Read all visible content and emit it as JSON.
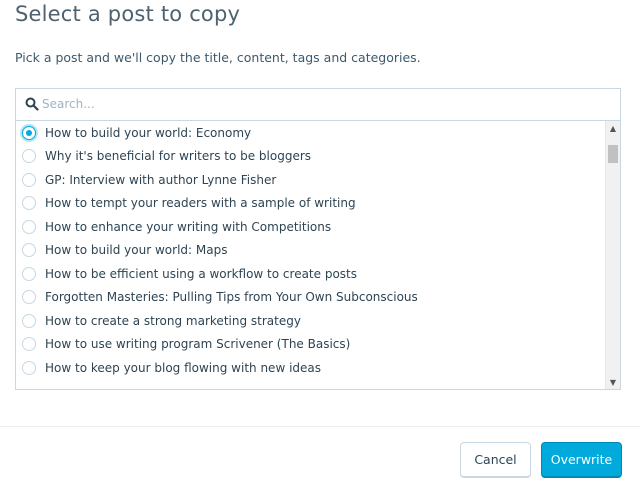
{
  "dialog": {
    "title": "Select a post to copy",
    "subtitle": "Pick a post and we'll copy the title, content, tags and categories."
  },
  "search": {
    "placeholder": "Search...",
    "value": ""
  },
  "posts": [
    {
      "label": "How to build your world: Economy",
      "selected": true
    },
    {
      "label": "Why it's beneficial for writers to be bloggers",
      "selected": false
    },
    {
      "label": "GP: Interview with author Lynne Fisher",
      "selected": false
    },
    {
      "label": "How to tempt your readers with a sample of writing",
      "selected": false
    },
    {
      "label": "How to enhance your writing with Competitions",
      "selected": false
    },
    {
      "label": "How to build your world: Maps",
      "selected": false
    },
    {
      "label": "How to be efficient using a workflow to create posts",
      "selected": false
    },
    {
      "label": "Forgotten Masteries: Pulling Tips from Your Own Subconscious",
      "selected": false
    },
    {
      "label": "How to create a strong marketing strategy",
      "selected": false
    },
    {
      "label": "How to use writing program Scrivener (The Basics)",
      "selected": false
    },
    {
      "label": "How to keep your blog flowing with new ideas",
      "selected": false
    }
  ],
  "buttons": {
    "cancel": "Cancel",
    "overwrite": "Overwrite"
  },
  "colors": {
    "accent": "#00aadc",
    "border": "#c8d7e1",
    "text": "#2e4453"
  },
  "icons": {
    "search": "search-icon",
    "scroll_up": "scroll-up-arrow-icon",
    "scroll_down": "scroll-down-arrow-icon"
  }
}
